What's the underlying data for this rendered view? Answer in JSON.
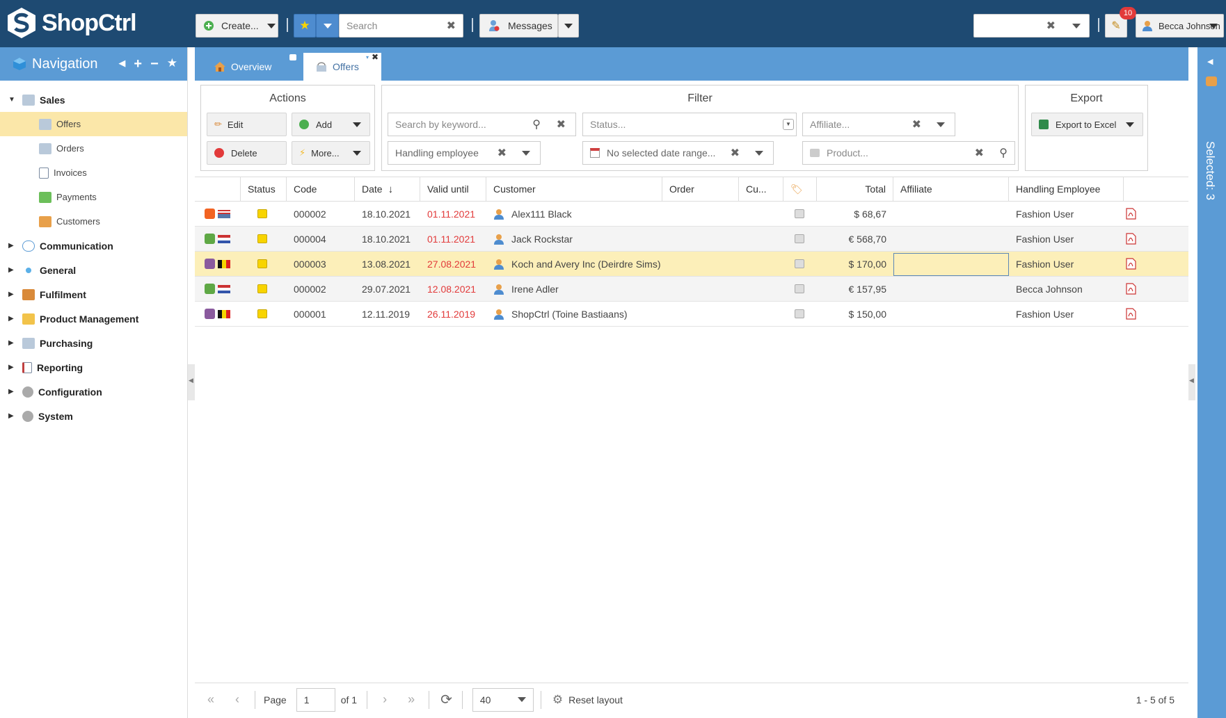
{
  "app": {
    "name": "ShopCtrl"
  },
  "toolbar": {
    "create_label": "Create...",
    "search_placeholder": "Search",
    "messages_label": "Messages",
    "notifications_count": "10",
    "user_name": "Becca Johnson"
  },
  "nav": {
    "title": "Navigation",
    "items": [
      {
        "label": "Sales"
      },
      {
        "label": "Offers"
      },
      {
        "label": "Orders"
      },
      {
        "label": "Invoices"
      },
      {
        "label": "Payments"
      },
      {
        "label": "Customers"
      },
      {
        "label": "Communication"
      },
      {
        "label": "General"
      },
      {
        "label": "Fulfilment"
      },
      {
        "label": "Product Management"
      },
      {
        "label": "Purchasing"
      },
      {
        "label": "Reporting"
      },
      {
        "label": "Configuration"
      },
      {
        "label": "System"
      }
    ]
  },
  "tabs": [
    {
      "label": "Overview"
    },
    {
      "label": "Offers"
    }
  ],
  "actions": {
    "title": "Actions",
    "edit": "Edit",
    "add": "Add",
    "delete": "Delete",
    "more": "More..."
  },
  "filter": {
    "title": "Filter",
    "keyword_placeholder": "Search by keyword...",
    "status_placeholder": "Status...",
    "affiliate_placeholder": "Affiliate...",
    "handling_employee": "Handling employee",
    "date_range": "No selected date range...",
    "product_placeholder": "Product..."
  },
  "export": {
    "title": "Export",
    "excel": "Export to Excel"
  },
  "grid": {
    "columns": [
      "Status",
      "Code",
      "Date",
      "Valid until",
      "Customer",
      "Order",
      "Cu...",
      "Total",
      "Affiliate",
      "Handling Employee"
    ],
    "rows": [
      {
        "code": "000002",
        "date": "18.10.2021",
        "valid": "01.11.2021",
        "customer": "Alex111 Black",
        "order": "",
        "total": "$ 68,67",
        "affiliate": "",
        "employee": "Fashion User",
        "shop": "magento",
        "flag": "us"
      },
      {
        "code": "000004",
        "date": "18.10.2021",
        "valid": "01.11.2021",
        "customer": "Jack Rockstar",
        "order": "",
        "total": "€ 568,70",
        "affiliate": "",
        "employee": "Fashion User",
        "shop": "shopify",
        "flag": "nl"
      },
      {
        "code": "000003",
        "date": "13.08.2021",
        "valid": "27.08.2021",
        "customer": "Koch and Avery Inc (Deirdre Sims)",
        "order": "",
        "total": "$ 170,00",
        "affiliate": "",
        "employee": "Fashion User",
        "shop": "woo",
        "flag": "be"
      },
      {
        "code": "000002",
        "date": "29.07.2021",
        "valid": "12.08.2021",
        "customer": "Irene Adler",
        "order": "",
        "total": "€ 157,95",
        "affiliate": "",
        "employee": "Becca Johnson",
        "shop": "shopify",
        "flag": "nl"
      },
      {
        "code": "000001",
        "date": "12.11.2019",
        "valid": "26.11.2019",
        "customer": "ShopCtrl (Toine Bastiaans)",
        "order": "",
        "total": "$ 150,00",
        "affiliate": "",
        "employee": "Fashion User",
        "shop": "woo",
        "flag": "be"
      }
    ]
  },
  "pager": {
    "page_label": "Page",
    "page_value": "1",
    "of_label": "of 1",
    "page_size": "40",
    "reset_layout": "Reset layout",
    "summary": "1 - 5 of 5"
  },
  "right_panel": {
    "selected_label": "Selected: 3"
  },
  "colors": {
    "topbar": "#1e4a72",
    "accent": "#5b9bd5",
    "selected_row": "#fcefb9",
    "red": "#e23a3a"
  }
}
